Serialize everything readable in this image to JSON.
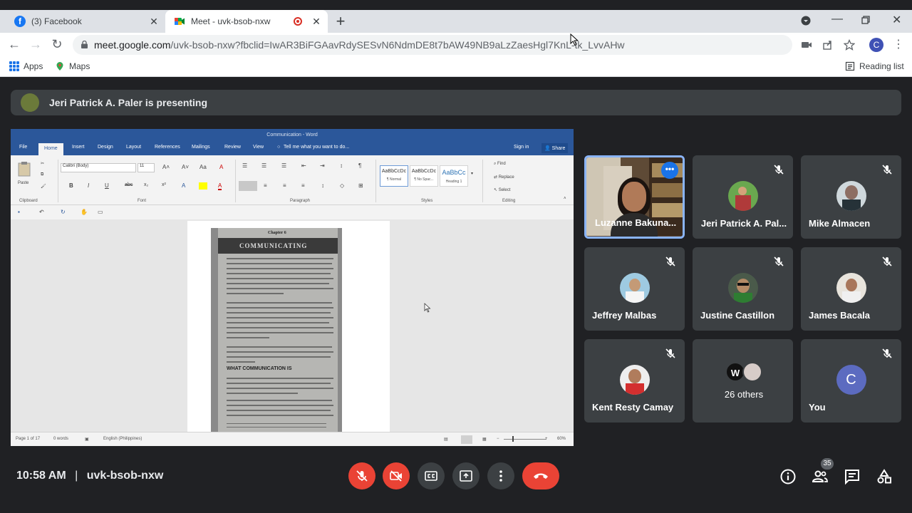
{
  "browser": {
    "tabs": [
      {
        "title": "(3) Facebook",
        "favicon": "facebook-icon",
        "active": false
      },
      {
        "title": "Meet - uvk-bsob-nxw",
        "favicon": "google-meet-icon",
        "active": true,
        "recording": true
      }
    ],
    "new_tab_label": "+",
    "url_host": "meet.google.com",
    "url_path": "/uvk-bsob-nxw?fbclid=IwAR3BiFGAavRdySESvN6NdmDE8t7bAW49NB9aLzZaesHgl7KnL-tk_LvvAHw",
    "profile_initial": "C",
    "bookmarks": [
      {
        "label": "Apps",
        "icon": "apps-grid-icon"
      },
      {
        "label": "Maps",
        "icon": "maps-pin-icon"
      }
    ],
    "reading_list": "Reading list"
  },
  "meet": {
    "presenting_text": "Jeri Patrick A. Paler is presenting",
    "meeting_time": "10:58 AM",
    "meeting_code": "uvk-bsob-nxw",
    "participant_count": "35",
    "participants": [
      {
        "name": "Luzanne Bakuna...",
        "speaking_tile": true
      },
      {
        "name": "Jeri Patrick A. Pal...",
        "muted": true
      },
      {
        "name": "Mike Almacen",
        "muted": true
      },
      {
        "name": "Jeffrey Malbas",
        "muted": true
      },
      {
        "name": "Justine Castillon",
        "muted": true
      },
      {
        "name": "James Bacala",
        "muted": true
      },
      {
        "name": "Kent Resty Camay",
        "muted": true
      },
      {
        "name": "26 others",
        "others_initial": "W"
      },
      {
        "name": "You",
        "initial": "C",
        "muted": true
      }
    ]
  },
  "word": {
    "title": "Communication - Word",
    "tabs": [
      "File",
      "Home",
      "Insert",
      "Design",
      "Layout",
      "References",
      "Mailings",
      "Review",
      "View"
    ],
    "tell_me": "Tell me what you want to do...",
    "sign_in": "Sign in",
    "share": "Share",
    "font_name": "Calibri (Body)",
    "font_size": "11",
    "paste_label": "Paste",
    "groups": [
      "Clipboard",
      "Font",
      "Paragraph",
      "Styles",
      "Editing"
    ],
    "styles": [
      {
        "preview": "AaBbCcDc",
        "name": "¶ Normal"
      },
      {
        "preview": "AaBbCcDc",
        "name": "¶ No Spac..."
      },
      {
        "preview": "AaBbCc",
        "name": "Heading 1"
      }
    ],
    "editing": [
      "Find",
      "Replace",
      "Select"
    ],
    "status_page": "Page 1 of 17",
    "status_words": "0 words",
    "status_lang": "English (Philippines)",
    "zoom": "60%",
    "book": {
      "chapter": "Chapter 6",
      "heading": "COMMUNICATING",
      "subheading": "WHAT COMMUNICATION IS"
    }
  }
}
